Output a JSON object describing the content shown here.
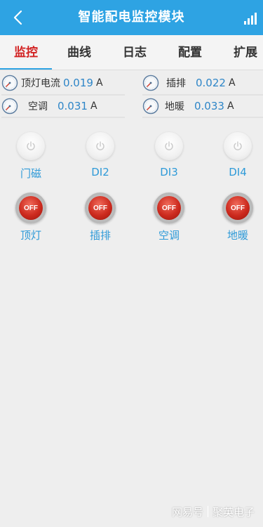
{
  "header": {
    "title": "智能配电监控模块",
    "back_icon": "chevron-left-icon",
    "signal_icon": "signal-bars-icon",
    "background_color": "#2ea3e3"
  },
  "tabs": [
    {
      "label": "监控",
      "active": true
    },
    {
      "label": "曲线",
      "active": false
    },
    {
      "label": "日志",
      "active": false
    },
    {
      "label": "配置",
      "active": false
    },
    {
      "label": "扩展",
      "active": false
    }
  ],
  "readings": [
    {
      "label": "顶灯电流",
      "value": "0.019",
      "unit": "A"
    },
    {
      "label": "插排",
      "value": "0.022",
      "unit": "A"
    },
    {
      "label": "空调",
      "value": "0.031",
      "unit": "A"
    },
    {
      "label": "地暖",
      "value": "0.033",
      "unit": "A"
    }
  ],
  "digital_inputs": [
    {
      "label": "门磁"
    },
    {
      "label": "DI2"
    },
    {
      "label": "DI3"
    },
    {
      "label": "DI4"
    }
  ],
  "relays": [
    {
      "label": "顶灯",
      "state": "OFF"
    },
    {
      "label": "插排",
      "state": "OFF"
    },
    {
      "label": "空调",
      "state": "OFF"
    },
    {
      "label": "地暖",
      "state": "OFF"
    }
  ],
  "watermark": {
    "left": "网易号",
    "right": "聚英电子"
  }
}
